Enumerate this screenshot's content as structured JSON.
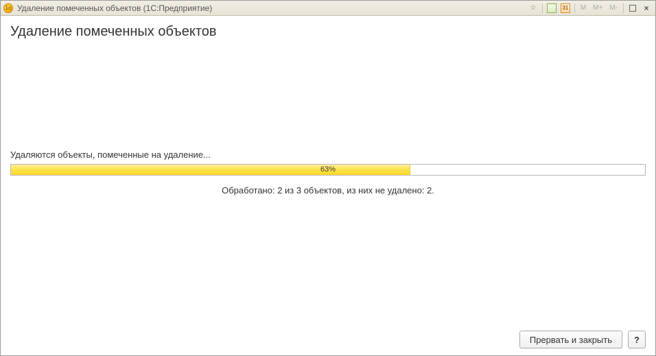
{
  "titlebar": {
    "app_icon_text": "1c",
    "title": "Удаление помеченных объектов  (1С:Предприятие)",
    "calendar_day": "31",
    "m_label": "M",
    "m_plus_label": "M+",
    "m_minus_label": "M-"
  },
  "main": {
    "page_title": "Удаление помеченных объектов",
    "status_text": "Удаляются объекты, помеченные на удаление...",
    "progress": {
      "percent": 63,
      "label": "63%"
    },
    "processed_text": "Обработано: 2 из 3 объектов, из них не удалено: 2."
  },
  "footer": {
    "cancel_label": "Прервать и закрыть",
    "help_label": "?"
  }
}
